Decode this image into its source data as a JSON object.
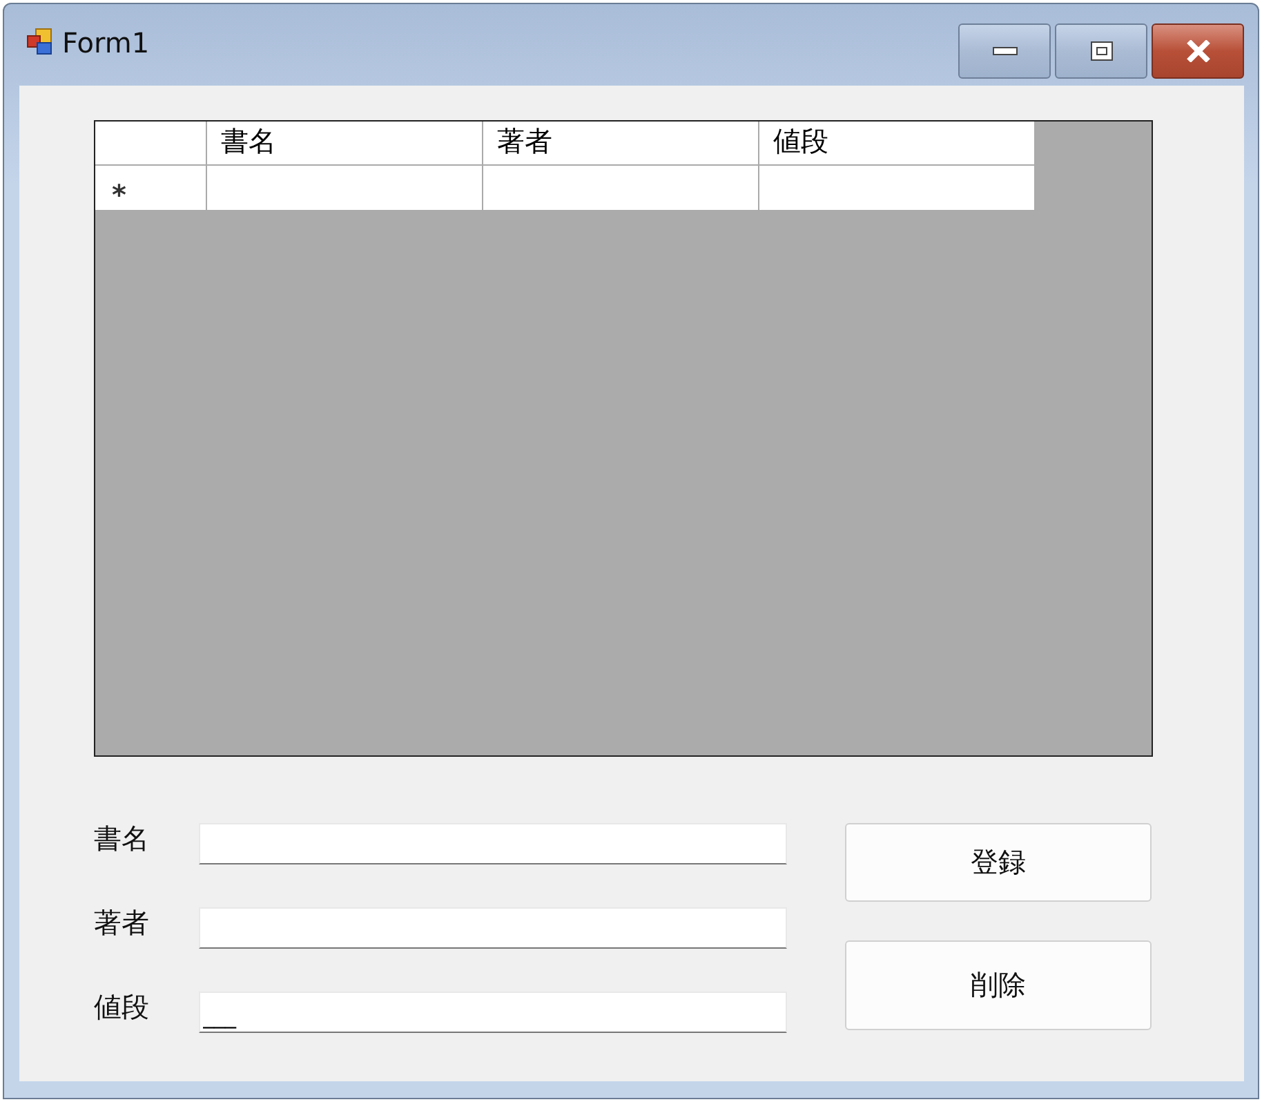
{
  "window": {
    "title": "Form1"
  },
  "table": {
    "columns": [
      "書名",
      "著者",
      "値段"
    ],
    "rows": [
      {
        "header": "*"
      }
    ]
  },
  "fields": [
    {
      "label": "書名"
    },
    {
      "label": "著者"
    },
    {
      "label": "値段",
      "value": "___"
    }
  ],
  "buttons": [
    "登録",
    "削除"
  ]
}
